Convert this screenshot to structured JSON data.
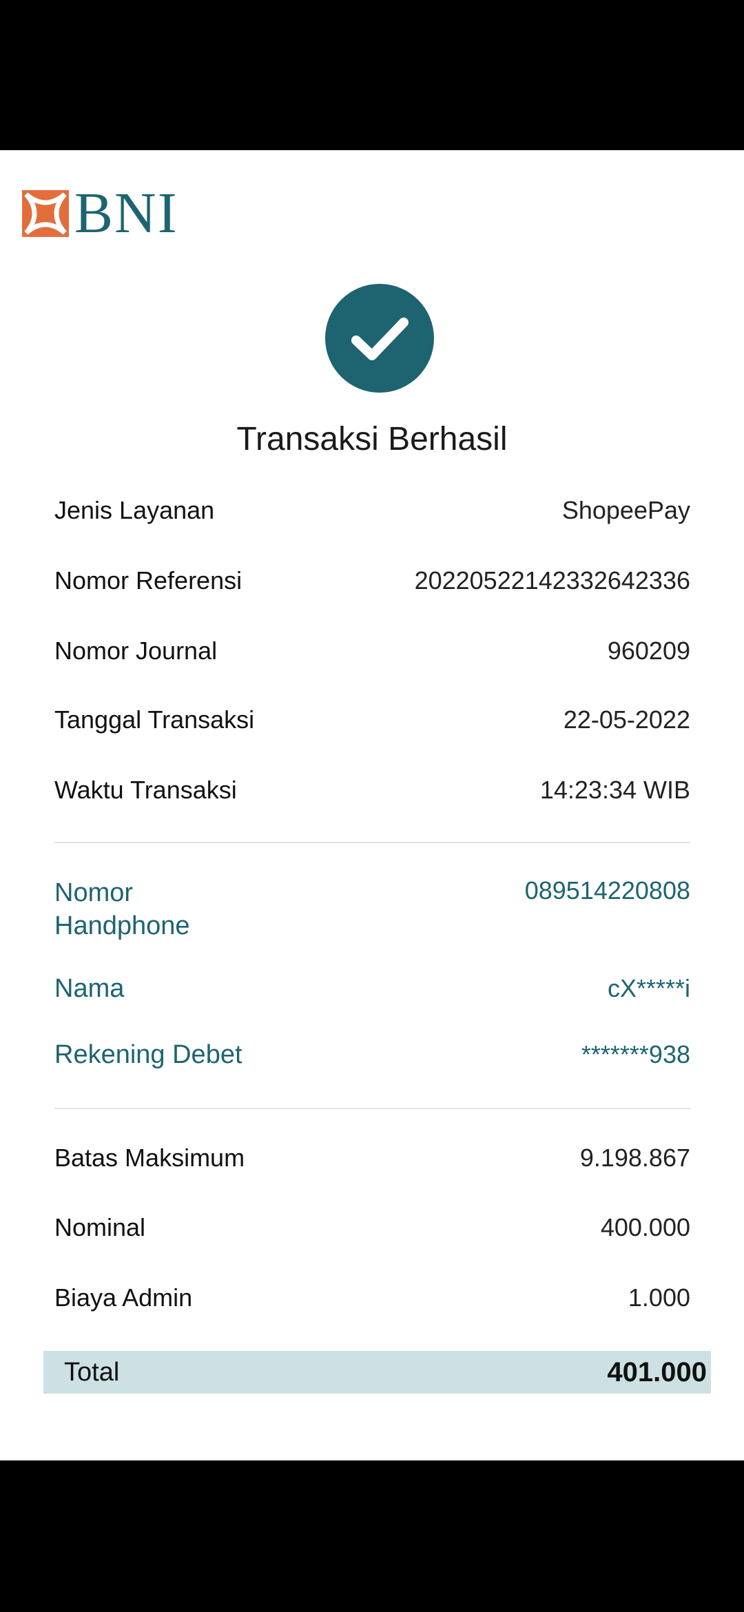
{
  "logo": {
    "brand": "BNI"
  },
  "watermark": {
    "text": "BNI"
  },
  "status": {
    "title": "Transaksi Berhasil",
    "icon": "check-icon"
  },
  "details": [
    {
      "label": "Jenis Layanan",
      "value": "ShopeePay"
    },
    {
      "label": "Nomor Referensi",
      "value": "20220522142332642336"
    },
    {
      "label": "Nomor Journal",
      "value": "960209"
    },
    {
      "label": "Tanggal Transaksi",
      "value": "22-05-2022"
    },
    {
      "label": "Waktu Transaksi",
      "value": "14:23:34 WIB"
    }
  ],
  "account": [
    {
      "label": "Nomor Handphone",
      "value": "089514220808"
    },
    {
      "label": "Nama",
      "value": "cX*****i"
    },
    {
      "label": "Rekening Debet",
      "value": "*******938"
    }
  ],
  "amounts": [
    {
      "label": "Batas Maksimum",
      "value": "9.198.867"
    },
    {
      "label": "Nominal",
      "value": "400.000"
    },
    {
      "label": "Biaya Admin",
      "value": "1.000"
    }
  ],
  "total": {
    "label": "Total",
    "value": "401.000"
  },
  "colors": {
    "brand_teal": "#1d6470",
    "brand_orange": "#e26e3c",
    "total_bg": "#cde0e3"
  }
}
